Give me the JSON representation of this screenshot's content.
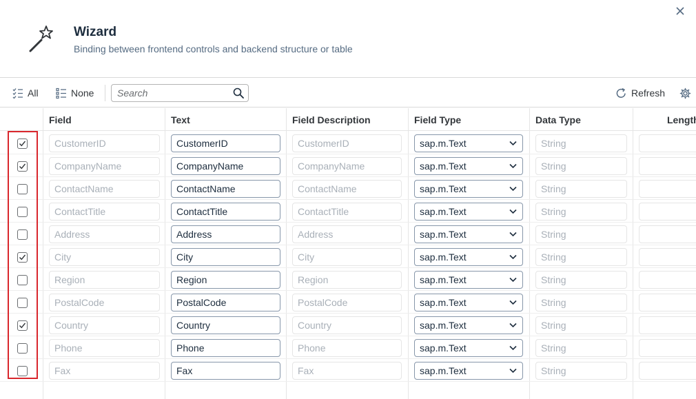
{
  "dialog": {
    "title": "Wizard",
    "subtitle": "Binding between frontend controls and backend structure or table"
  },
  "toolbar": {
    "all_label": "All",
    "none_label": "None",
    "search_placeholder": "Search",
    "refresh_label": "Refresh"
  },
  "columns": {
    "field": "Field",
    "text": "Text",
    "field_description": "Field Description",
    "field_type": "Field Type",
    "data_type": "Data Type",
    "length": "Length"
  },
  "rows": [
    {
      "checked": true,
      "field": "CustomerID",
      "text": "CustomerID",
      "description": "CustomerID",
      "field_type": "sap.m.Text",
      "data_type": "String"
    },
    {
      "checked": true,
      "field": "CompanyName",
      "text": "CompanyName",
      "description": "CompanyName",
      "field_type": "sap.m.Text",
      "data_type": "String"
    },
    {
      "checked": false,
      "field": "ContactName",
      "text": "ContactName",
      "description": "ContactName",
      "field_type": "sap.m.Text",
      "data_type": "String"
    },
    {
      "checked": false,
      "field": "ContactTitle",
      "text": "ContactTitle",
      "description": "ContactTitle",
      "field_type": "sap.m.Text",
      "data_type": "String"
    },
    {
      "checked": false,
      "field": "Address",
      "text": "Address",
      "description": "Address",
      "field_type": "sap.m.Text",
      "data_type": "String"
    },
    {
      "checked": true,
      "field": "City",
      "text": "City",
      "description": "City",
      "field_type": "sap.m.Text",
      "data_type": "String"
    },
    {
      "checked": false,
      "field": "Region",
      "text": "Region",
      "description": "Region",
      "field_type": "sap.m.Text",
      "data_type": "String"
    },
    {
      "checked": false,
      "field": "PostalCode",
      "text": "PostalCode",
      "description": "PostalCode",
      "field_type": "sap.m.Text",
      "data_type": "String"
    },
    {
      "checked": true,
      "field": "Country",
      "text": "Country",
      "description": "Country",
      "field_type": "sap.m.Text",
      "data_type": "String"
    },
    {
      "checked": false,
      "field": "Phone",
      "text": "Phone",
      "description": "Phone",
      "field_type": "sap.m.Text",
      "data_type": "String"
    },
    {
      "checked": false,
      "field": "Fax",
      "text": "Fax",
      "description": "Fax",
      "field_type": "sap.m.Text",
      "data_type": "String"
    }
  ],
  "colors": {
    "highlight": "#d9262c",
    "title": "#1d2d3e",
    "readonly_text": "#a9b0b8"
  }
}
